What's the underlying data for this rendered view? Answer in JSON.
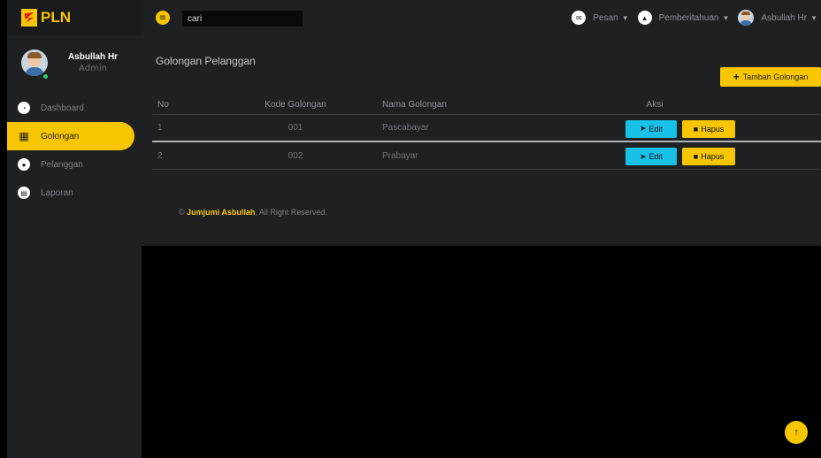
{
  "brand": {
    "logo_text": "PLN",
    "accent_color": "#f7c600"
  },
  "profile": {
    "name": "Asbullah Hr",
    "role": "Admin"
  },
  "sidebar": {
    "items": [
      {
        "label": "Dashboard",
        "icon": "dashboard-icon",
        "active": false
      },
      {
        "label": "Golongan",
        "icon": "grid-icon",
        "active": true
      },
      {
        "label": "Pelanggan",
        "icon": "users-icon",
        "active": false
      },
      {
        "label": "Laporan",
        "icon": "report-icon",
        "active": false
      }
    ]
  },
  "topbar": {
    "search_value": "cari",
    "messages_label": "Pesan",
    "notifications_label": "Pemberitahuan",
    "user_label": "Asbullah Hr"
  },
  "main": {
    "title": "Golongan Pelanggan",
    "add_button_label": "Tambah Golongan",
    "table": {
      "headers": [
        "No",
        "Kode Golongan",
        "Nama Golongan",
        "Aksi"
      ],
      "rows": [
        {
          "no": "1",
          "kode": "001",
          "nama": "Pascabayar"
        },
        {
          "no": "2",
          "kode": "002",
          "nama": "Prabayar"
        }
      ],
      "edit_label": "Edit",
      "delete_label": "Hapus"
    },
    "footer": {
      "prefix": "©",
      "author": "Jumjumi Asbullah",
      "suffix": ", All Right Reserved."
    }
  }
}
